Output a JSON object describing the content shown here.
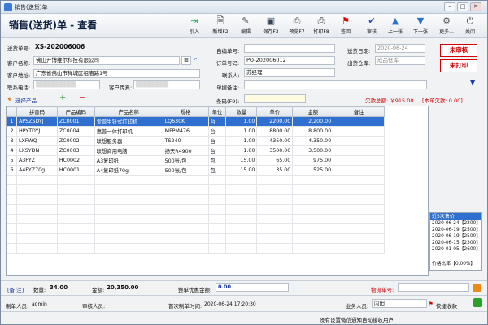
{
  "window": {
    "title": "销售(送货)单"
  },
  "toolbar": {
    "page_title": "销售(送货)单 - 查看",
    "buttons": [
      "引入",
      "新增F2",
      "编辑",
      "保存F3",
      "预览F7",
      "打印F8",
      "签回",
      "审核",
      "上一张",
      "下一张",
      "更多...",
      "关闭"
    ]
  },
  "header": {
    "order_no_label": "送货单号:",
    "order_no": "XS-202006006",
    "customer_label": "客户名称:",
    "customer": "佛山开博维尔科技有限公司",
    "address_label": "客户地址:",
    "address": "广东省佛山市禅城区祖庙路1号",
    "phone_label": "联系电话:",
    "fax_label": "客户传真:",
    "custom_no_label": "自编单号:",
    "custom_no": "",
    "po_label": "订单号码:",
    "po": "PO-202006012",
    "contact_label": "联系人:",
    "contact": "苏经理",
    "note_label": "单据备注:",
    "note": "",
    "date_label": "送货日期:",
    "date": "2020-06-24",
    "warehouse_label": "出货仓库:",
    "warehouse": "成品仓库",
    "unaudited": "未审核",
    "unprinted": "未打印",
    "owed_total": "欠款总额: ￥915.00",
    "owed_bill": "[本单欠款: 0.00]",
    "barcode_label": "条码(F9):",
    "choose_product": "选择产品"
  },
  "table": {
    "columns": [
      "",
      "拼音码",
      "产品编码",
      "产品名称",
      "规格",
      "单位",
      "数量",
      "单价",
      "金额",
      "备注"
    ],
    "rows": [
      [
        "1",
        "APSZSDYJ",
        "ZC0001",
        "爱普生针式打印机",
        "LQ630K",
        "台",
        "1.00",
        "2200.00",
        "2,200.00",
        ""
      ],
      [
        "2",
        "HPYTDYJ",
        "ZC0004",
        "惠普一体打印机",
        "MFPM476",
        "台",
        "1.00",
        "8800.00",
        "8,800.00",
        ""
      ],
      [
        "3",
        "LXFWQ",
        "ZC0002",
        "联想服务器",
        "TS240",
        "台",
        "1.00",
        "4350.00",
        "4,350.00",
        ""
      ],
      [
        "4",
        "LXSYDN",
        "ZC0003",
        "联想商用电脑",
        "扬天R4900",
        "台",
        "1.00",
        "3500.00",
        "3,500.00",
        ""
      ],
      [
        "5",
        "A3FYZ",
        "HC0002",
        "A3复印纸",
        "500张/包",
        "包",
        "15.00",
        "65.00",
        "975.00",
        ""
      ],
      [
        "6",
        "A4FYZ70g",
        "HC0001",
        "A4复印纸70g",
        "500张/包",
        "包",
        "15.00",
        "35.00",
        "525.00",
        ""
      ]
    ]
  },
  "recent_prices": {
    "title": "近5次售价",
    "rows": [
      "2020-06-24【2200】",
      "2020-06-19【2500】",
      "2020-06-19【2500】",
      "2020-06-15【2300】",
      "2020-01-05【2600】"
    ],
    "ratio": "价格比率【0.00%】"
  },
  "summary": {
    "note_tag": "[备 注]",
    "qty_label": "数量:",
    "qty": "34.00",
    "amount_label": "金额:",
    "amount": "20,350.00",
    "discount_label": "整单优惠金额:",
    "discount": "0.00",
    "tracking_label": "物流单号:"
  },
  "footer": {
    "maker_label": "制单人员:",
    "maker": "admin",
    "auditor_label": "审核人员:",
    "first_time_label": "首次制单时间:",
    "first_time": "2020-06-24 17:20:30",
    "sales_label": "业务人员:",
    "sales": "闫田",
    "quick_receive": "快捷收款",
    "notice": "没有设置微信通知自动接收用户"
  }
}
